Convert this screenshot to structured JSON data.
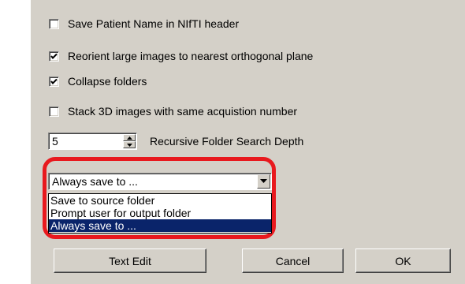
{
  "options": {
    "save_patient_name": {
      "label": "Save Patient Name in NIfTI header",
      "checked": false
    },
    "reorient": {
      "label": "Reorient large images to nearest orthogonal plane",
      "checked": true
    },
    "collapse_folders": {
      "label": "Collapse folders",
      "checked": true
    },
    "stack_3d": {
      "label": "Stack 3D images with same acquistion number",
      "checked": false
    }
  },
  "depth": {
    "value": "5",
    "label": "Recursive Folder Search Depth"
  },
  "output_folder": {
    "selected": "Always save to ...",
    "options": [
      "Save to source folder",
      "Prompt user for output folder",
      "Always save to ..."
    ],
    "highlight_index": 2
  },
  "buttons": {
    "text_edit": "Text Edit",
    "cancel": "Cancel",
    "ok": "OK"
  },
  "colors": {
    "dialog_bg": "#d4d0c8",
    "selection": "#0a246a",
    "highlight_ring": "#e8191e"
  }
}
